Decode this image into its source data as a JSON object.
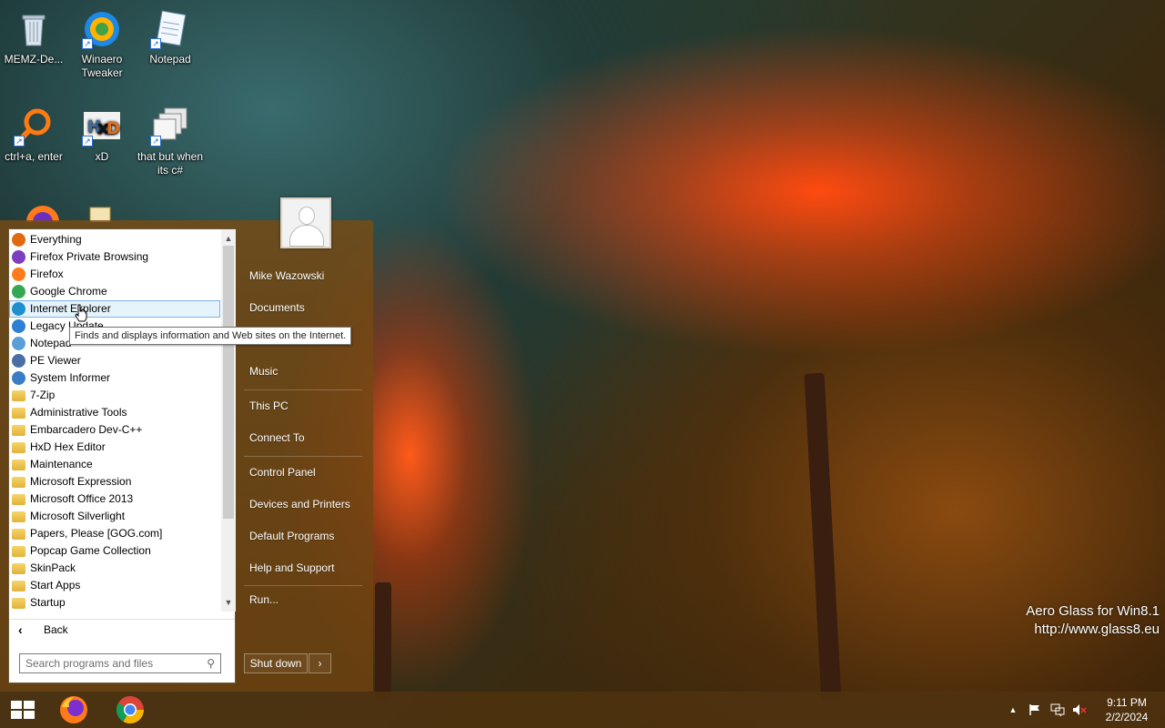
{
  "desktop": {
    "icons": [
      {
        "label": "MEMZ-De...",
        "icon": "recycle-bin-icon"
      },
      {
        "label": "Winaero Tweaker",
        "icon": "winaero-icon"
      },
      {
        "label": "Notepad",
        "icon": "notepad-icon"
      },
      {
        "label": "ctrl+a, enter",
        "icon": "magnifier-icon"
      },
      {
        "label": "xD",
        "icon": "hxd-icon"
      },
      {
        "label": "that but when its c#",
        "icon": "windows-stack-icon"
      }
    ],
    "watermark": {
      "line1": "Aero Glass for Win8.1",
      "line2": "http://www.glass8.eu"
    }
  },
  "start_menu": {
    "programs": [
      {
        "label": "Everything",
        "icon": "magnifier-icon",
        "color": "#e06a10"
      },
      {
        "label": "Firefox Private Browsing",
        "icon": "firefox-private-icon",
        "color": "#7b3fbf"
      },
      {
        "label": "Firefox",
        "icon": "firefox-icon",
        "color": "#ff7a1a"
      },
      {
        "label": "Google Chrome",
        "icon": "chrome-icon",
        "color": "#34a853"
      },
      {
        "label": "Internet Explorer",
        "icon": "ie-icon",
        "color": "#1e90d0"
      },
      {
        "label": "Legacy Update",
        "icon": "legacy-update-icon",
        "color": "#2d7fd3"
      },
      {
        "label": "Notepad",
        "icon": "notepad-icon",
        "color": "#5aa0d8"
      },
      {
        "label": "PE Viewer",
        "icon": "pe-viewer-icon",
        "color": "#4a6fa5"
      },
      {
        "label": "System Informer",
        "icon": "system-informer-icon",
        "color": "#3b7dc4"
      },
      {
        "label": "7-Zip",
        "icon": "folder-icon"
      },
      {
        "label": "Administrative Tools",
        "icon": "folder-icon"
      },
      {
        "label": "Embarcadero Dev-C++",
        "icon": "folder-icon"
      },
      {
        "label": "HxD Hex Editor",
        "icon": "folder-icon"
      },
      {
        "label": "Maintenance",
        "icon": "folder-icon"
      },
      {
        "label": "Microsoft Expression",
        "icon": "folder-icon"
      },
      {
        "label": "Microsoft Office 2013",
        "icon": "folder-icon"
      },
      {
        "label": "Microsoft Silverlight",
        "icon": "folder-icon"
      },
      {
        "label": "Papers, Please [GOG.com]",
        "icon": "folder-icon"
      },
      {
        "label": "Popcap Game Collection",
        "icon": "folder-icon"
      },
      {
        "label": "SkinPack",
        "icon": "folder-icon"
      },
      {
        "label": "Start Apps",
        "icon": "folder-icon"
      },
      {
        "label": "Startup",
        "icon": "folder-icon"
      }
    ],
    "highlighted_index": 4,
    "back_label": "Back",
    "search_placeholder": "Search programs and files",
    "tooltip": "Finds and displays information and Web sites on the Internet.",
    "right_items": {
      "user": "Mike Wazowski",
      "documents": "Documents",
      "music": "Music",
      "this_pc": "This PC",
      "connect_to": "Connect To",
      "control_panel": "Control Panel",
      "devices_printers": "Devices and Printers",
      "default_programs": "Default Programs",
      "help_support": "Help and Support",
      "run": "Run..."
    },
    "shutdown_label": "Shut down",
    "shutdown_arrow": "›"
  },
  "taskbar": {
    "pinned": [
      "firefox-icon",
      "chrome-icon"
    ],
    "tray": {
      "chevron": "▲",
      "time": "9:11 PM",
      "date": "2/2/2024"
    }
  }
}
